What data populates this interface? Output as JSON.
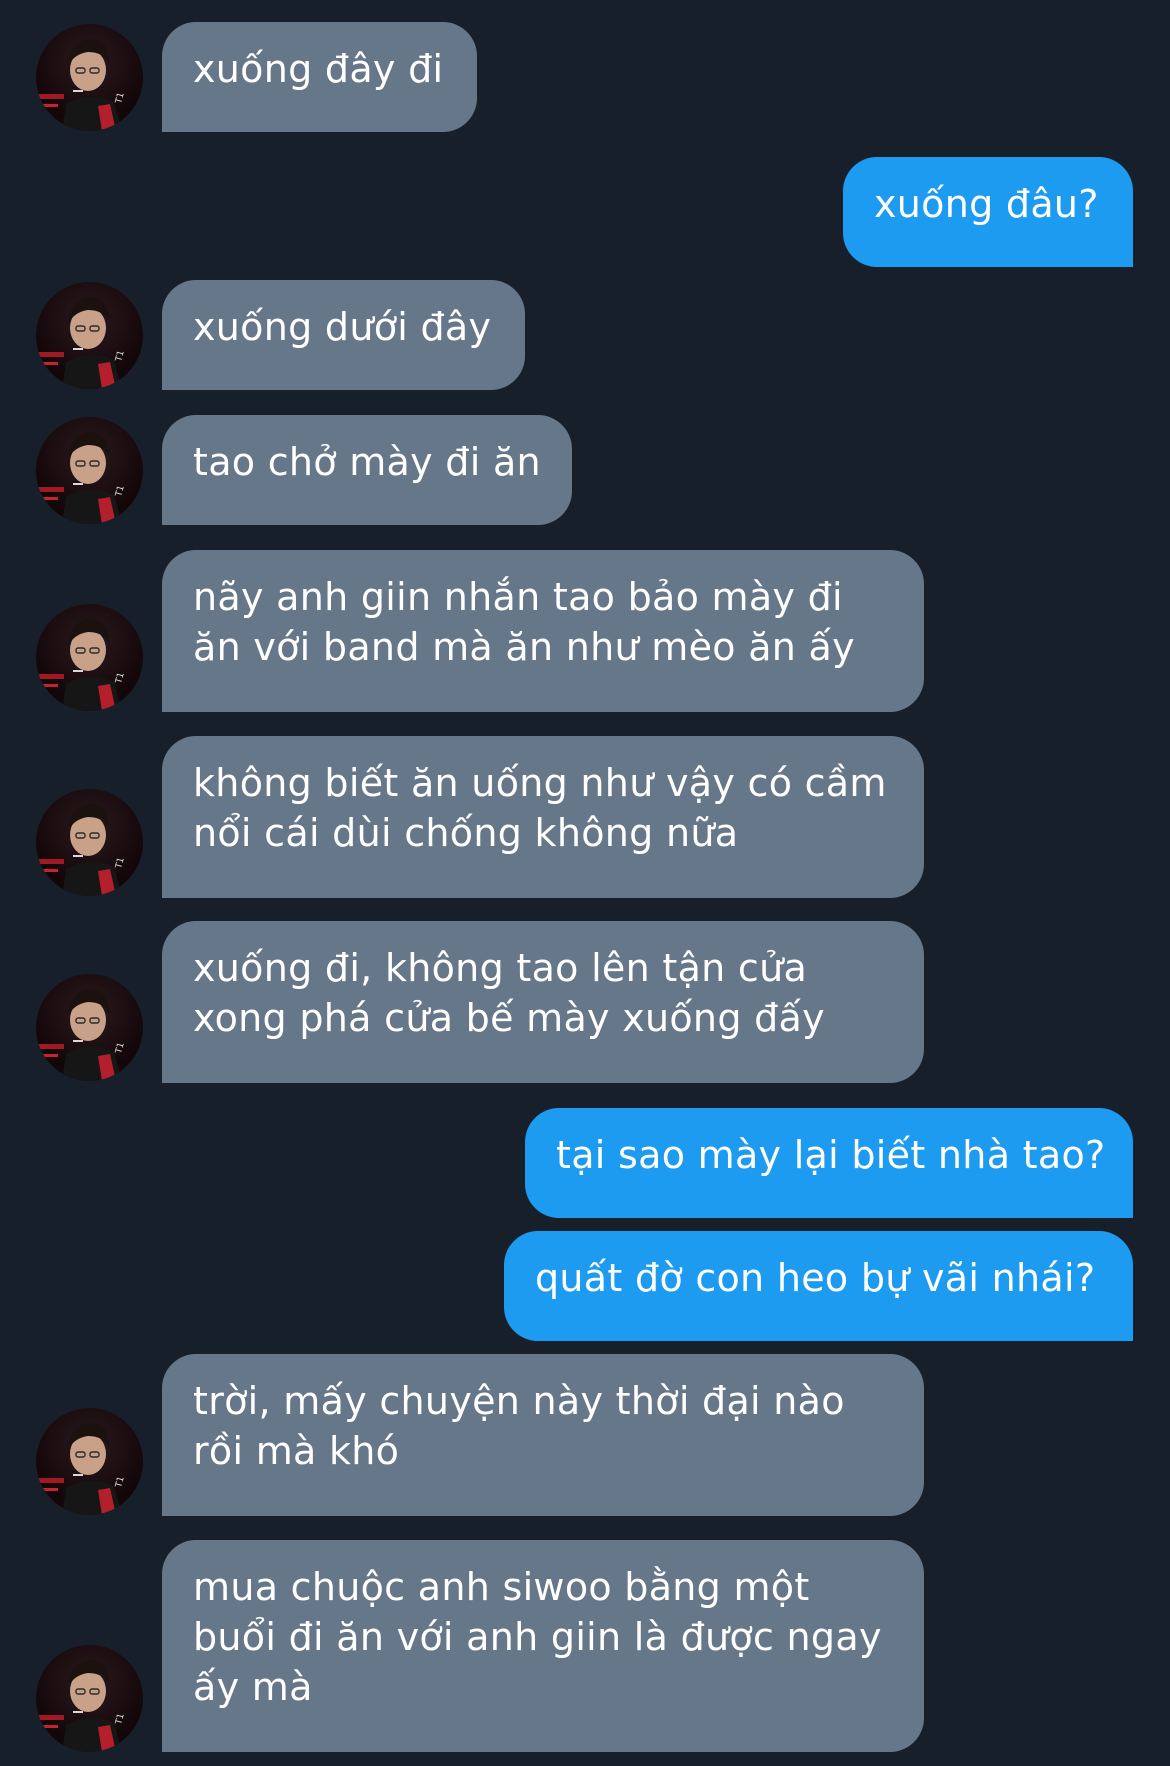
{
  "accent_color": "#1d9bf0",
  "incoming_bubble_color": "#66778a",
  "background_color": "#17202a",
  "messages": [
    {
      "sender": "them",
      "text": "xuống đây đi"
    },
    {
      "sender": "me",
      "text": "xuống đâu?"
    },
    {
      "sender": "them",
      "text": "xuống dưới đây"
    },
    {
      "sender": "them",
      "text": "tao chở mày đi ăn"
    },
    {
      "sender": "them",
      "line1": "nãy anh giin nhắn tao bảo mày đi",
      "line2": "ăn với band mà ăn như mèo ăn ấy"
    },
    {
      "sender": "them",
      "line1": "không biết ăn uống như vậy có cầm",
      "line2": "nổi cái dùi chống không nữa"
    },
    {
      "sender": "them",
      "line1": "xuống đi, không tao lên tận cửa",
      "line2": "xong phá cửa bế mày xuống đấy"
    },
    {
      "sender": "me",
      "text": "tại sao mày lại biết nhà tao?"
    },
    {
      "sender": "me",
      "text": "quất đờ con heo bự vãi nhái?"
    },
    {
      "sender": "them",
      "line1": "trời, mấy chuyện này thời đại nào",
      "line2": "rồi mà khó"
    },
    {
      "sender": "them",
      "line1": "mua chuộc anh siwoo bằng một",
      "line2": "buổi đi ăn với anh giin là được ngay",
      "line3": "ấy mà"
    }
  ],
  "icons": {
    "avatar": "user-avatar-icon"
  }
}
